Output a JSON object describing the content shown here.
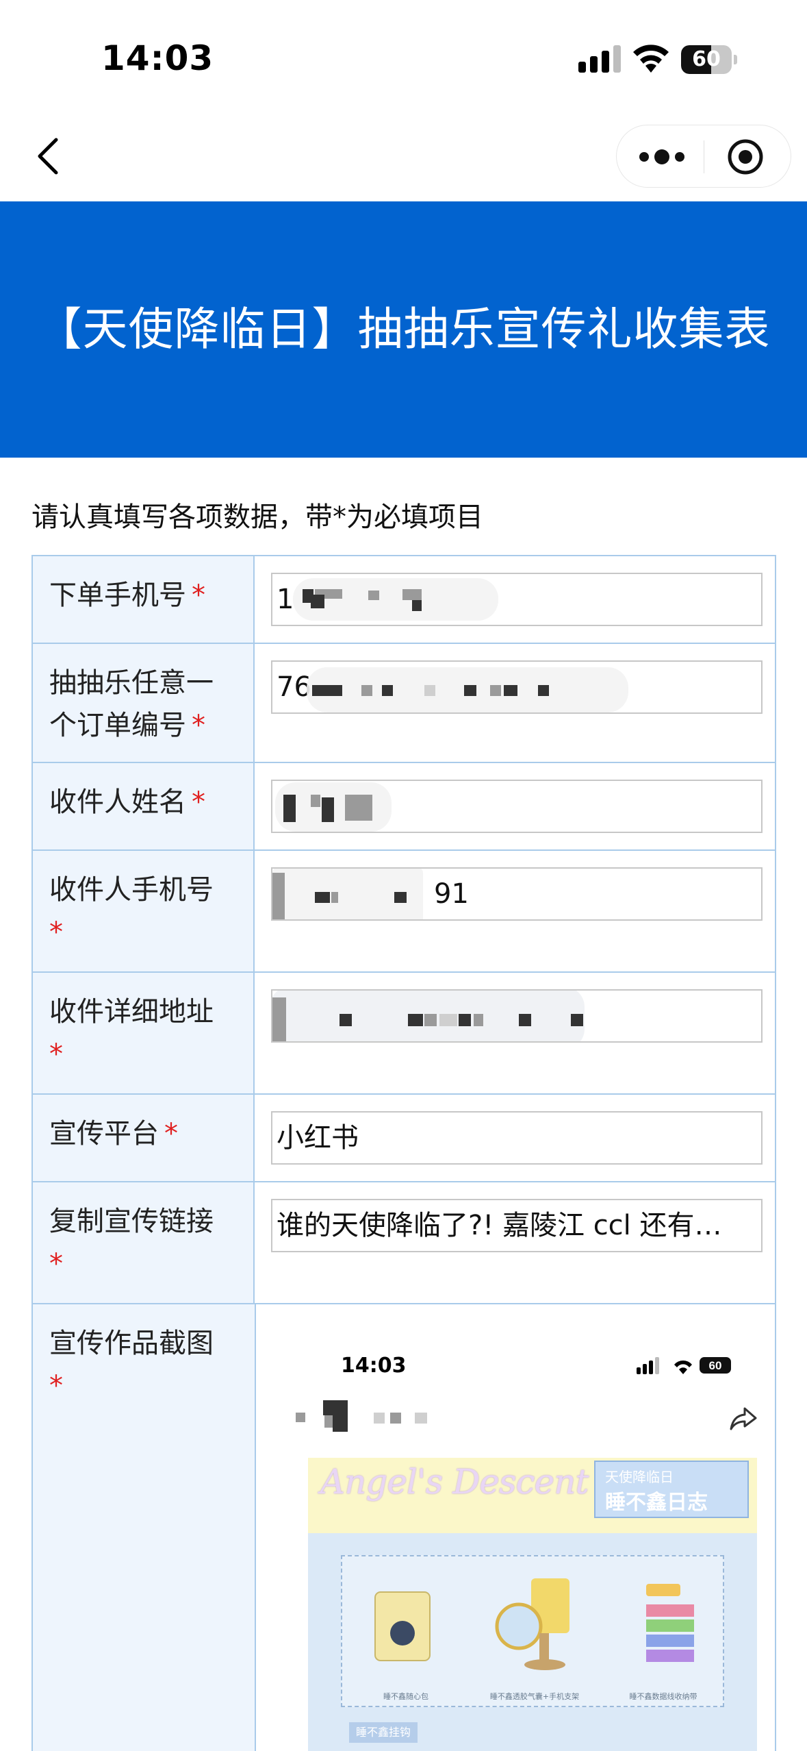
{
  "status_bar": {
    "time": "14:03",
    "battery_level": "60",
    "battery_fraction": 0.6,
    "icons": [
      "signal-icon",
      "wifi-icon",
      "battery-icon"
    ]
  },
  "nav": {
    "icons": [
      "back-chevron-icon",
      "more-dots-icon",
      "close-target-icon"
    ]
  },
  "banner": {
    "title": "【天使降临日】抽抽乐宣传礼收集表",
    "color": "#0263cf"
  },
  "hint": "请认真填写各项数据，带*为必填项目",
  "required_mark": "*",
  "fields": [
    {
      "label": "下单手机号",
      "value": "1"
    },
    {
      "label": "抽抽乐任意一个订单编号",
      "value": "76"
    },
    {
      "label": "收件人姓名",
      "value": ""
    },
    {
      "label": "收件人手机号",
      "value": "91"
    },
    {
      "label": "收件详细地址",
      "value": ""
    },
    {
      "label": "宣传平台",
      "value": "小红书"
    },
    {
      "label": "复制宣传链接",
      "value": "谁的天使降临了?!  嘉陵江 ccl 还有…"
    },
    {
      "label": "宣传作品截图"
    }
  ],
  "screenshot": {
    "time": "14:03",
    "battery_level": "60",
    "logo_text": "Angel's Descent Day",
    "tag_small": "天使降临日",
    "tag_big": "睡不鑫日志",
    "captions": [
      "睡不鑫随心包",
      "睡不鑫透胶气囊+手机支架",
      "睡不鑫数据线收纳带"
    ],
    "section_label": "睡不鑫挂钩"
  }
}
